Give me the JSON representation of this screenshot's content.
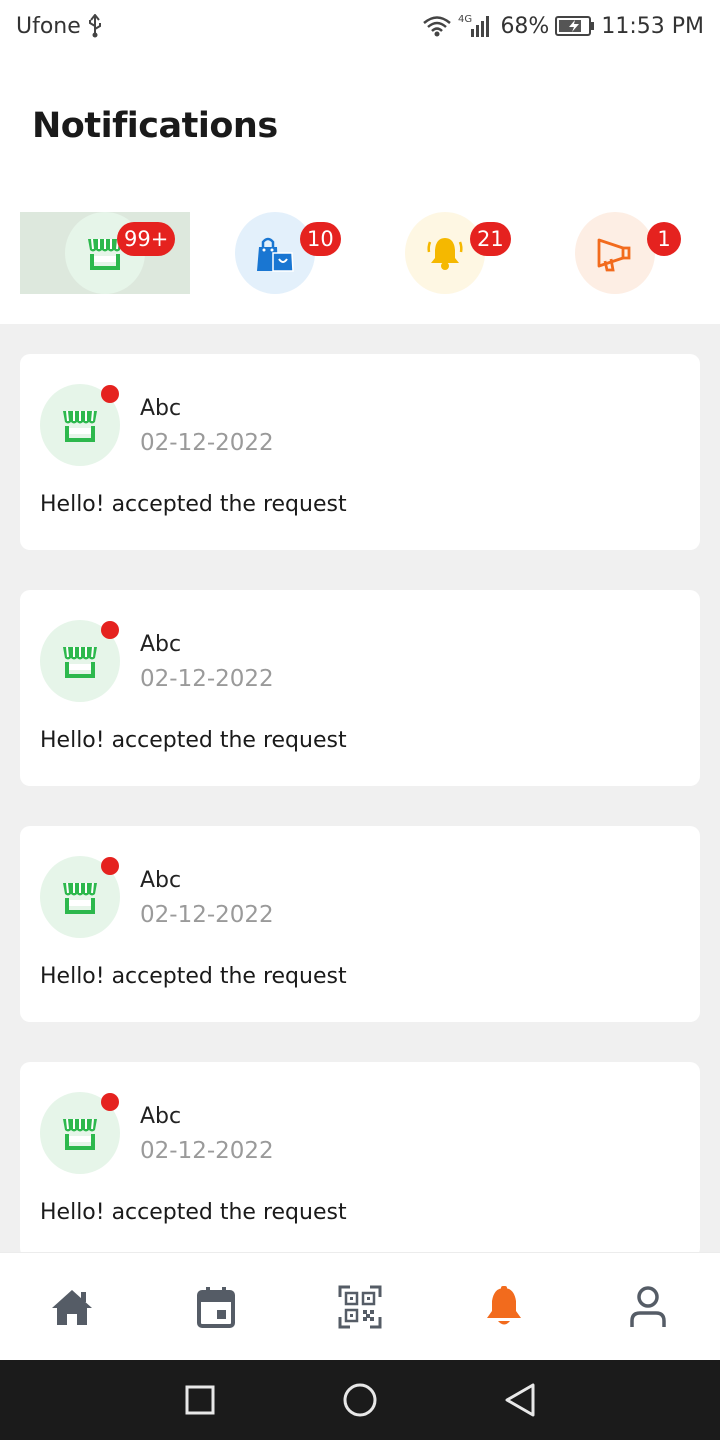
{
  "status_bar": {
    "carrier": "Ufone",
    "network": "4G",
    "battery": "68%",
    "time": "11:53 PM",
    "icons": [
      "usb-icon",
      "wifi-icon",
      "signal-icon",
      "battery-icon"
    ]
  },
  "header": {
    "title": "Notifications"
  },
  "categories": [
    {
      "name": "store",
      "icon": "store-icon",
      "badge": "99+",
      "color": "#2db84d",
      "bg": "#e6f5e9",
      "active": true
    },
    {
      "name": "shopping",
      "icon": "shopping-bags-icon",
      "badge": "10",
      "color": "#1976d2",
      "bg": "#e3f0fb",
      "active": false
    },
    {
      "name": "alerts",
      "icon": "bell-icon",
      "badge": "21",
      "color": "#f5b800",
      "bg": "#fef7e3",
      "active": false
    },
    {
      "name": "announcements",
      "icon": "megaphone-icon",
      "badge": "1",
      "color": "#f26b1d",
      "bg": "#fdeee4",
      "active": false
    }
  ],
  "notifications": [
    {
      "icon": "store-icon",
      "name": "Abc",
      "date": "02-12-2022",
      "message": "Hello! accepted the request",
      "unread": true
    },
    {
      "icon": "store-icon",
      "name": "Abc",
      "date": "02-12-2022",
      "message": "Hello! accepted the request",
      "unread": true
    },
    {
      "icon": "store-icon",
      "name": "Abc",
      "date": "02-12-2022",
      "message": "Hello! accepted the request",
      "unread": true
    },
    {
      "icon": "store-icon",
      "name": "Abc",
      "date": "02-12-2022",
      "message": "Hello! accepted the request",
      "unread": true
    }
  ],
  "bottom_nav": {
    "items": [
      {
        "icon": "home-icon",
        "active": false
      },
      {
        "icon": "calendar-icon",
        "active": false
      },
      {
        "icon": "qr-code-icon",
        "active": false
      },
      {
        "icon": "bell-icon",
        "active": true
      },
      {
        "icon": "profile-icon",
        "active": false
      }
    ],
    "active_color": "#f26b1d",
    "inactive_color": "#555c66"
  },
  "system_nav": [
    "square-icon",
    "circle-icon",
    "back-triangle-icon"
  ]
}
